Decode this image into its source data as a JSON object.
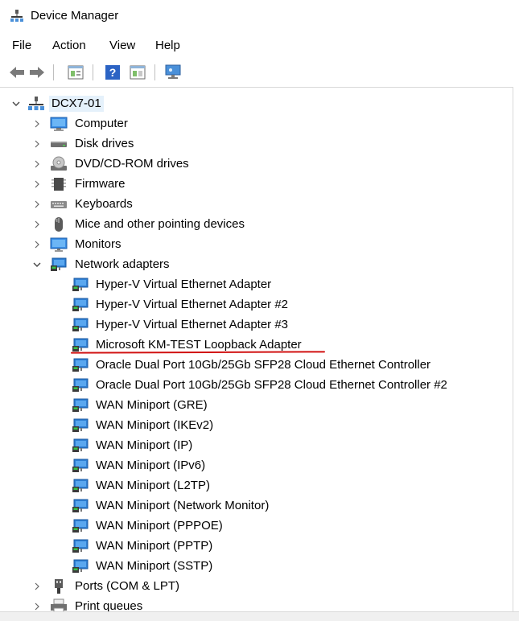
{
  "window": {
    "title": "Device Manager",
    "title_icon": "device-manager-icon"
  },
  "menu": [
    "File",
    "Action",
    "View",
    "Help"
  ],
  "toolbar": [
    "back-arrow-icon",
    "forward-arrow-icon",
    "properties-icon",
    "help-icon",
    "update-driver-icon",
    "monitor-scan-icon"
  ],
  "tree": {
    "root": {
      "label": "DCX7-01",
      "icon": "computer-network-icon",
      "expanded": true
    },
    "categories": [
      {
        "label": "Computer",
        "icon": "computer-icon",
        "expanded": false
      },
      {
        "label": "Disk drives",
        "icon": "disk-drive-icon",
        "expanded": false
      },
      {
        "label": "DVD/CD-ROM drives",
        "icon": "dvd-drive-icon",
        "expanded": false
      },
      {
        "label": "Firmware",
        "icon": "firmware-icon",
        "expanded": false
      },
      {
        "label": "Keyboards",
        "icon": "keyboard-icon",
        "expanded": false
      },
      {
        "label": "Mice and other pointing devices",
        "icon": "mouse-icon",
        "expanded": false
      },
      {
        "label": "Monitors",
        "icon": "monitor-icon",
        "expanded": false
      },
      {
        "label": "Network adapters",
        "icon": "network-adapter-icon",
        "expanded": true,
        "children": [
          "Hyper-V Virtual Ethernet Adapter",
          "Hyper-V Virtual Ethernet Adapter #2",
          "Hyper-V Virtual Ethernet Adapter #3",
          "Microsoft KM-TEST Loopback Adapter",
          "Oracle Dual Port 10Gb/25Gb SFP28 Cloud Ethernet Controller",
          "Oracle Dual Port 10Gb/25Gb SFP28 Cloud Ethernet Controller #2",
          "WAN Miniport (GRE)",
          "WAN Miniport (IKEv2)",
          "WAN Miniport (IP)",
          "WAN Miniport (IPv6)",
          "WAN Miniport (L2TP)",
          "WAN Miniport (Network Monitor)",
          "WAN Miniport (PPPOE)",
          "WAN Miniport (PPTP)",
          "WAN Miniport (SSTP)"
        ]
      },
      {
        "label": "Ports (COM & LPT)",
        "icon": "port-icon",
        "expanded": false
      },
      {
        "label": "Print queues",
        "icon": "printer-icon",
        "expanded": false
      }
    ]
  },
  "annotation": {
    "highlighted_item": "Microsoft KM-TEST Loopback Adapter",
    "color": "#d11111"
  }
}
